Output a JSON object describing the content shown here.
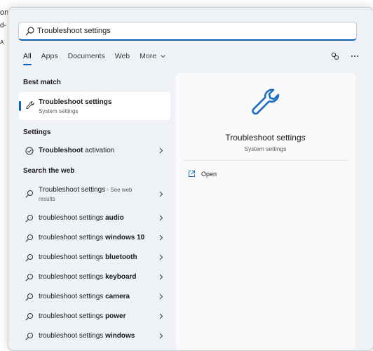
{
  "background_window": {
    "line1": "on",
    "line2": "d-",
    "line3": "A"
  },
  "search": {
    "value": "Troubleshoot settings",
    "placeholder": ""
  },
  "tabs": [
    {
      "label": "All",
      "active": true
    },
    {
      "label": "Apps"
    },
    {
      "label": "Documents"
    },
    {
      "label": "Web"
    },
    {
      "label": "More"
    }
  ],
  "top_icons": [
    "share-icon",
    "more-options-icon"
  ],
  "sections": {
    "best_match": "Best match",
    "settings": "Settings",
    "search_web": "Search the web"
  },
  "best_match": {
    "title": "Troubleshoot settings",
    "subtitle": "System settings",
    "icon": "wrench-icon"
  },
  "settings_items": [
    {
      "bold": "Troubleshoot",
      "rest": " activation",
      "icon": "check-circle-icon"
    }
  ],
  "web_first": {
    "text": "Troubleshoot settings",
    "suffix": " - See web",
    "line2": "results"
  },
  "web_items": [
    {
      "prefix": "troubleshoot settings ",
      "bold": "audio"
    },
    {
      "prefix": "troubleshoot settings ",
      "bold": "windows 10"
    },
    {
      "prefix": "troubleshoot settings ",
      "bold": "bluetooth"
    },
    {
      "prefix": "troubleshoot settings ",
      "bold": "keyboard"
    },
    {
      "prefix": "troubleshoot settings ",
      "bold": "camera"
    },
    {
      "prefix": "troubleshoot settings ",
      "bold": "power"
    },
    {
      "prefix": "troubleshoot settings ",
      "bold": "windows"
    }
  ],
  "preview": {
    "title": "Troubleshoot settings",
    "subtitle": "System settings",
    "open_label": "Open"
  },
  "colors": {
    "accent": "#0a5fb6",
    "panel": "#eef1f6",
    "preview": "#fafafa"
  }
}
